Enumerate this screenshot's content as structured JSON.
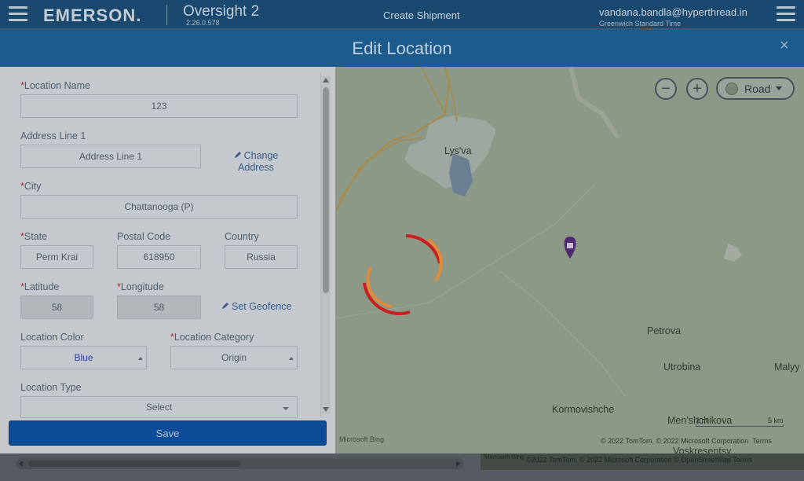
{
  "topbar": {
    "logo": "EMERSON.",
    "app_name": "Oversight 2",
    "version": "2.26.0.578",
    "create_shipment": "Create Shipment",
    "user_email": "vandana.bandla@hyperthread.in",
    "timezone": "Greenwich Standard Time",
    "menu_icon": "hamburger-menu-icon"
  },
  "modal": {
    "title": "Edit Location",
    "close": "×",
    "close_icon": "close-icon"
  },
  "form": {
    "location_name": {
      "label": "Location Name",
      "required": "*",
      "value": "123"
    },
    "address_line_1": {
      "label": "Address Line 1",
      "placeholder": "Address Line 1"
    },
    "change_address": {
      "line1": "Change",
      "line2": "Address",
      "icon": "pencil-icon"
    },
    "city": {
      "label": "City",
      "required": "*",
      "value": "Chattanooga (P)"
    },
    "state": {
      "label": "State",
      "required": "*",
      "value": "Perm Krai"
    },
    "postal_code": {
      "label": "Postal Code",
      "value": "618950"
    },
    "country": {
      "label": "Country",
      "value": "Russia"
    },
    "latitude": {
      "label": "Latitude",
      "required": "*",
      "value": "58"
    },
    "longitude": {
      "label": "Longitude",
      "required": "*",
      "value": "58"
    },
    "set_geofence": {
      "label": "Set Geofence",
      "icon": "pencil-icon"
    },
    "location_color": {
      "label": "Location Color",
      "value": "Blue",
      "color": "#2c3bb4"
    },
    "location_category": {
      "label": "Location Category",
      "required": "*",
      "value": "Origin"
    },
    "location_type": {
      "label": "Location Type",
      "value": "Select"
    },
    "save": "Save"
  },
  "map": {
    "zoom_out": "−",
    "zoom_in": "+",
    "map_style": "Road",
    "places": {
      "lysva": "Lys'va",
      "petrova": "Petrova",
      "utrobina": "Utrobina",
      "malyy": "Malyy",
      "kormovishche": "Kormovishche",
      "menshchikova": "Men'shchikova",
      "voskresentsy": "Voskresentsy"
    },
    "scale_mi": "2 mi",
    "scale_km": "5 km",
    "bing": "Microsoft Bing",
    "copyright": "© 2022 TomTom, © 2022 Microsoft Corporation",
    "terms": "Terms",
    "marker_icon": "location-marker-icon",
    "loading_icon": "loading-spinner-icon"
  },
  "background": {
    "copyright": "©2022 TomTom, © 2022 Microsoft Corporation  © OpenStreetMap   Terms",
    "bing": "Microsoft Bing"
  },
  "colors": {
    "header": "#19496e",
    "modal_header": "#1b5b8e",
    "save_button": "#0d4c97",
    "required": "#b52929",
    "marker": "#4e2b6e",
    "spinner_red": "#cc1f1f",
    "spinner_orange": "#e08a3a"
  }
}
